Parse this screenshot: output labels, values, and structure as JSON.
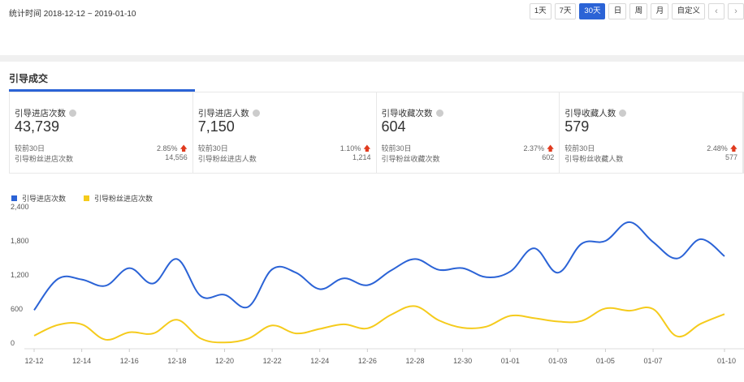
{
  "header": {
    "date_range": "统计时间 2018-12-12 ~ 2019-01-10",
    "tabs": [
      "1天",
      "7天",
      "30天",
      "日",
      "周",
      "月",
      "自定义"
    ],
    "active_tab": "30天",
    "prev_symbol": "‹",
    "next_symbol": "›"
  },
  "section": {
    "title": "引导成交"
  },
  "cards": [
    {
      "title": "引导进店次数",
      "value": "43,739",
      "compare_label": "较前30日",
      "compare_value": "2.85%",
      "sub_label": "引导粉丝进店次数",
      "sub_value": "14,556"
    },
    {
      "title": "引导进店人数",
      "value": "7,150",
      "compare_label": "较前30日",
      "compare_value": "1.10%",
      "sub_label": "引导粉丝进店人数",
      "sub_value": "1,214"
    },
    {
      "title": "引导收藏次数",
      "value": "604",
      "compare_label": "较前30日",
      "compare_value": "2.37%",
      "sub_label": "引导粉丝收藏次数",
      "sub_value": "602"
    },
    {
      "title": "引导收藏人数",
      "value": "579",
      "compare_label": "较前30日",
      "compare_value": "2.48%",
      "sub_label": "引导粉丝收藏人数",
      "sub_value": "577"
    }
  ],
  "colors": {
    "accent": "#2b63d6",
    "series_blue": "#2b63d6",
    "series_yellow": "#f5cb1c",
    "up": "#e03a1e"
  },
  "chart_data": {
    "type": "line",
    "title": "",
    "xlabel": "",
    "ylabel": "",
    "ylim": [
      0,
      2400
    ],
    "yticks": [
      "0",
      "600",
      "1,200",
      "1,800",
      "2,400"
    ],
    "xticks": [
      "12-12",
      "12-14",
      "12-16",
      "12-18",
      "12-20",
      "12-22",
      "12-24",
      "12-26",
      "12-28",
      "12-30",
      "01-01",
      "01-03",
      "01-05",
      "01-07",
      "01-10"
    ],
    "x": [
      "12-12",
      "12-13",
      "12-14",
      "12-15",
      "12-16",
      "12-17",
      "12-18",
      "12-19",
      "12-20",
      "12-21",
      "12-22",
      "12-23",
      "12-24",
      "12-25",
      "12-26",
      "12-27",
      "12-28",
      "12-29",
      "12-30",
      "12-31",
      "01-01",
      "01-02",
      "01-03",
      "01-04",
      "01-05",
      "01-06",
      "01-07",
      "01-08",
      "01-09",
      "01-10"
    ],
    "legend_position": "top-left",
    "grid": true,
    "series": [
      {
        "name": "引导进店次数",
        "color": "#2b63d6",
        "values": [
          680,
          1230,
          1220,
          1110,
          1420,
          1150,
          1580,
          930,
          950,
          740,
          1400,
          1340,
          1050,
          1240,
          1120,
          1380,
          1580,
          1390,
          1420,
          1260,
          1360,
          1770,
          1340,
          1850,
          1900,
          2230,
          1880,
          1590,
          1930,
          1630
        ]
      },
      {
        "name": "引导粉丝进店次数",
        "color": "#f5cb1c",
        "values": [
          230,
          420,
          430,
          160,
          290,
          270,
          510,
          180,
          110,
          180,
          410,
          270,
          350,
          430,
          360,
          600,
          750,
          500,
          370,
          390,
          580,
          540,
          480,
          490,
          710,
          670,
          700,
          220,
          440,
          610
        ]
      }
    ]
  }
}
